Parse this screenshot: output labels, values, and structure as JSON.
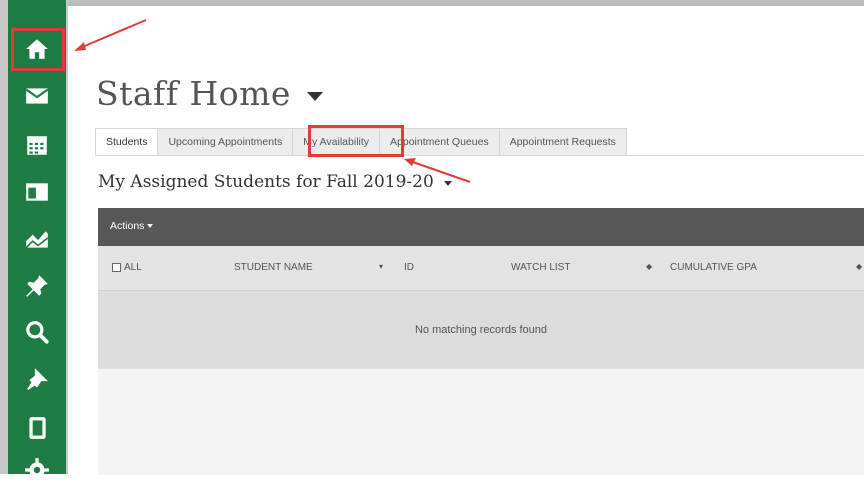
{
  "sidebar": {
    "items": [
      {
        "icon": "home-icon"
      },
      {
        "icon": "envelope-icon"
      },
      {
        "icon": "calendar-icon"
      },
      {
        "icon": "folder-icon"
      },
      {
        "icon": "chart-icon"
      },
      {
        "icon": "pushpin-icon"
      },
      {
        "icon": "search-icon"
      },
      {
        "icon": "pin-icon"
      },
      {
        "icon": "document-icon"
      },
      {
        "icon": "gear-icon"
      }
    ],
    "active_color": "#1e7b43"
  },
  "page": {
    "title": "Staff Home"
  },
  "tabs": [
    {
      "label": "Students",
      "active": true
    },
    {
      "label": "Upcoming Appointments"
    },
    {
      "label": "My Availability"
    },
    {
      "label": "Appointment Queues"
    },
    {
      "label": "Appointment Requests"
    }
  ],
  "section": {
    "title": "My Assigned Students for Fall 2019-20"
  },
  "table": {
    "actions_label": "Actions",
    "columns": {
      "all": "ALL",
      "student_name": "STUDENT NAME",
      "id": "ID",
      "watch_list": "WATCH LIST",
      "cumulative_gpa": "CUMULATIVE GPA"
    },
    "empty_message": "No matching records found"
  },
  "annotation": {
    "color": "#e13a3a"
  }
}
